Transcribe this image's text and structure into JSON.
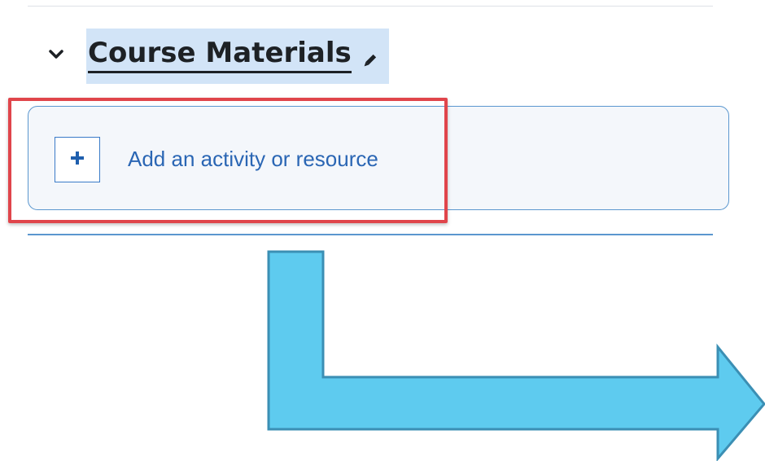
{
  "section": {
    "title": "Course Materials",
    "toggle_icon": "chevron-down-icon",
    "edit_icon": "pencil-icon"
  },
  "activity": {
    "add_label": "Add an activity or resource",
    "add_icon": "plus-icon"
  },
  "annotation": {
    "highlight_color": "#e0454b",
    "arrow_color": "#5ecbef",
    "arrow_outline": "#3b8fb4"
  },
  "colors": {
    "title_highlight": "#d2e4f7",
    "link": "#2a66b4",
    "border": "#5b97cf"
  }
}
